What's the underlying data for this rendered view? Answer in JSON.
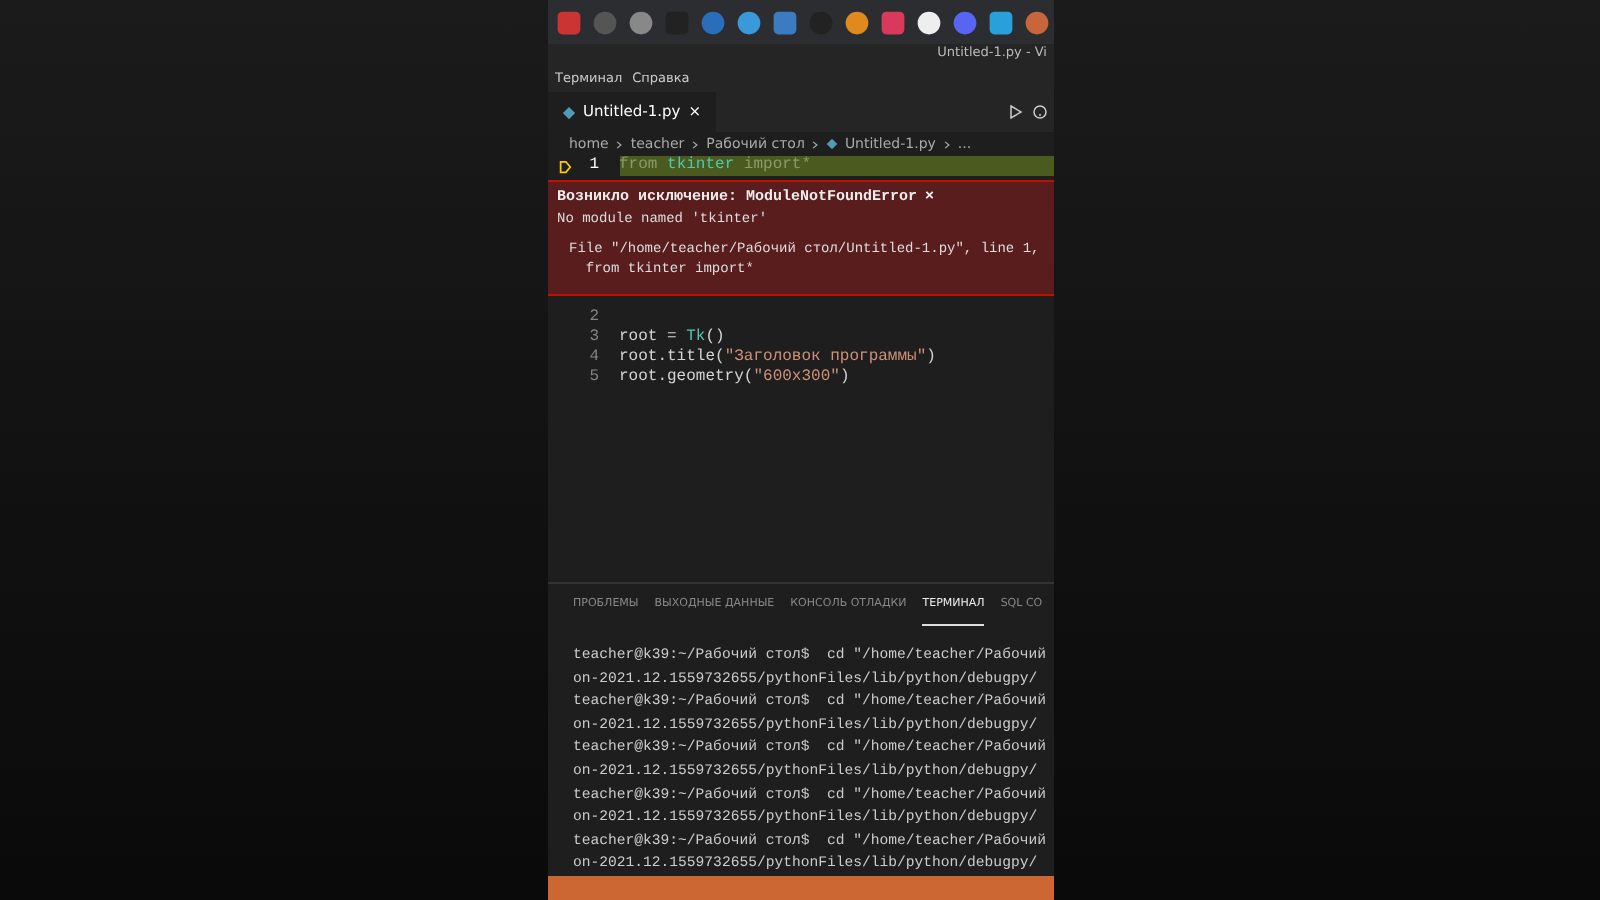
{
  "window": {
    "title": "Untitled-1.py - Vi"
  },
  "menu": [
    "Терминал",
    "Справка"
  ],
  "tabs": [
    {
      "label": "Untitled-1.py",
      "selected": true,
      "close": "×"
    }
  ],
  "breadcrumb": [
    "home",
    "teacher",
    "Рабочий стол",
    "Untitled-1.py",
    "..."
  ],
  "code_lines": [
    {
      "number": "1",
      "current": true,
      "tokens": [
        {
          "text": "from ",
          "kind": "keyword"
        },
        {
          "text": "tkinter",
          "kind": "module"
        },
        {
          "text": " import*",
          "kind": "keyword"
        }
      ]
    },
    {
      "number": "2",
      "current": false
    },
    {
      "number": "3",
      "current": false,
      "tokens": [
        {
          "text": "root = ",
          "kind": "plain"
        },
        {
          "text": "Tk",
          "kind": "class"
        },
        {
          "text": "()",
          "kind": "plain"
        }
      ]
    },
    {
      "number": "4",
      "current": false,
      "tokens": [
        {
          "text": "root.title(",
          "kind": "plain"
        },
        {
          "text": "\"Заголовок программы\"",
          "kind": "string"
        },
        {
          "text": ")",
          "kind": "plain"
        }
      ]
    },
    {
      "number": "5",
      "current": false,
      "tokens": [
        {
          "text": "root.geometry(",
          "kind": "plain"
        },
        {
          "text": "\"600x300\"",
          "kind": "string"
        },
        {
          "text": ")",
          "kind": "plain"
        }
      ]
    }
  ],
  "exception": {
    "title": "Возникло исключение: ModuleNotFoundError",
    "close": "×",
    "message": "No module named 'tkinter'",
    "trace": [
      "File \"/home/teacher/Рабочий стол/Untitled-1.py\", line 1,",
      "  from tkinter import*"
    ]
  },
  "panel_tabs": [
    {
      "label": "ПРОБЛЕМЫ",
      "selected": false
    },
    {
      "label": "ВЫХОДНЫЕ ДАННЫЕ",
      "selected": false
    },
    {
      "label": "КОНСОЛЬ ОТЛАДКИ",
      "selected": false
    },
    {
      "label": "ТЕРМИНАЛ",
      "selected": true
    },
    {
      "label": "SQL CO",
      "selected": false
    }
  ],
  "terminal": [
    "teacher@k39:~/Рабочий стол$  cd \"/home/teacher/Рабочий",
    "on-2021.12.1559732655/pythonFiles/lib/python/debugpy/",
    "teacher@k39:~/Рабочий стол$  cd \"/home/teacher/Рабочий",
    "on-2021.12.1559732655/pythonFiles/lib/python/debugpy/",
    "teacher@k39:~/Рабочий стол$  cd \"/home/teacher/Рабочий",
    "on-2021.12.1559732655/pythonFiles/lib/python/debugpy/",
    "teacher@k39:~/Рабочий стол$  cd \"/home/teacher/Рабочий",
    "on-2021.12.1559732655/pythonFiles/lib/python/debugpy/",
    "teacher@k39:~/Рабочий стол$  cd \"/home/teacher/Рабочий",
    "on-2021.12.1559732655/pythonFiles/lib/python/debugpy/"
  ]
}
